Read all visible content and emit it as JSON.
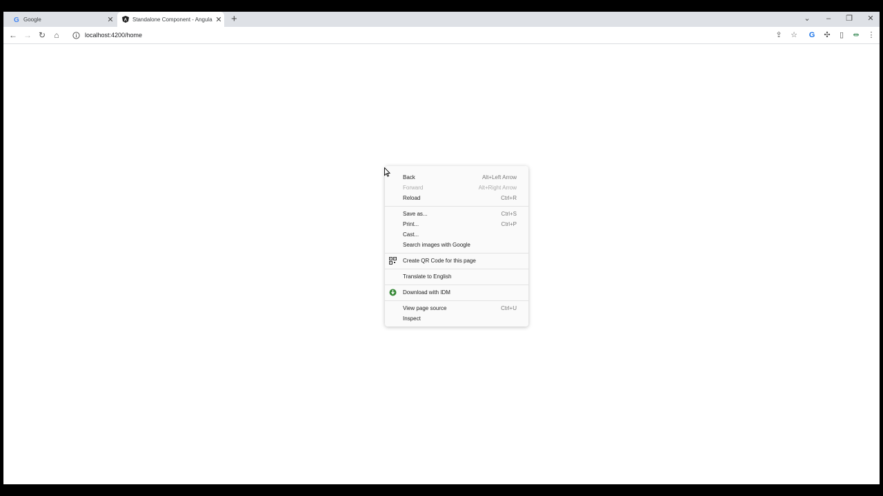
{
  "browser": {
    "tabs": [
      {
        "title": "Google",
        "favicon": "google-g-icon",
        "active": false
      },
      {
        "title": "Standalone Component - Angula",
        "favicon": "angular-icon",
        "active": true
      }
    ],
    "address": "localhost:4200/home"
  },
  "context_menu": {
    "items": [
      {
        "label": "Back",
        "shortcut": "Alt+Left Arrow"
      },
      {
        "label": "Forward",
        "shortcut": "Alt+Right Arrow",
        "disabled": true
      },
      {
        "label": "Reload",
        "shortcut": "Ctrl+R"
      },
      {
        "label": "Save as...",
        "shortcut": "Ctrl+S"
      },
      {
        "label": "Print...",
        "shortcut": "Ctrl+P"
      },
      {
        "label": "Cast..."
      },
      {
        "label": "Search images with Google"
      },
      {
        "label": "Create QR Code for this page",
        "icon": "qr-code-icon"
      },
      {
        "label": "Translate to English"
      },
      {
        "label": "Download with IDM",
        "icon": "idm-icon"
      },
      {
        "label": "View page source",
        "shortcut": "Ctrl+U"
      },
      {
        "label": "Inspect"
      }
    ]
  },
  "colors": {
    "tabstrip": "#dee1e6",
    "menu_bg": "#fafafa",
    "frame": "#000000"
  }
}
